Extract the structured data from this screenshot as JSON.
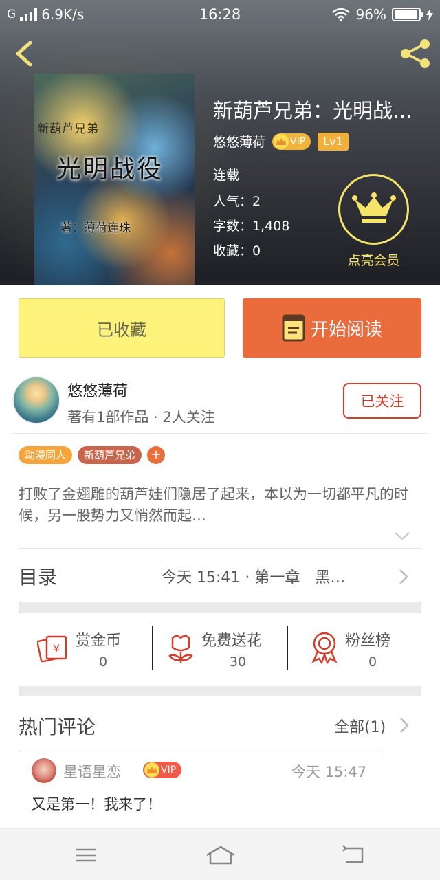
{
  "status_bar": {
    "carrier": "G",
    "speed": "6.9K/s",
    "time": "16:28",
    "battery": "96%"
  },
  "book": {
    "title": "新葫芦兄弟：光明战…",
    "author": "悠悠薄荷",
    "vip_text": "VIP",
    "level": "Lv1",
    "status": "连载",
    "popularity": "人气：2",
    "word_count": "字数：1,408",
    "favorites": "收藏：0",
    "cover": {
      "series": "新葫芦兄弟",
      "title": "光明战役",
      "author": "著：薄荷连珠"
    }
  },
  "member_badge": {
    "label": "点亮会员"
  },
  "buttons": {
    "collected": "已收藏",
    "start_reading": "开始阅读"
  },
  "author_section": {
    "name": "悠悠薄荷",
    "meta": "著有1部作品 · 2人关注",
    "follow": "已关注"
  },
  "tags": [
    {
      "label": "动漫同人",
      "color": "#f5a53a"
    },
    {
      "label": "新葫芦兄弟",
      "color": "#c8664c"
    }
  ],
  "tag_add": "+",
  "description": "打败了金翅雕的葫芦娃们隐居了起来，本以为一切都平凡的时候，另一股势力又悄然而起…",
  "toc": {
    "label": "目录",
    "update": "今天 15:41 · 第一章　黑…"
  },
  "actions": [
    {
      "label": "赏金币",
      "value": "0",
      "icon": "money-envelope-icon"
    },
    {
      "label": "免费送花",
      "value": "30",
      "icon": "flower-icon"
    },
    {
      "label": "粉丝榜",
      "value": "0",
      "icon": "medal-icon"
    }
  ],
  "comments_section": {
    "title": "热门评论",
    "all_link": "全部(1)",
    "items": [
      {
        "user": "星语星恋",
        "vip": "VIP",
        "time": "今天 15:47",
        "text": "又是第一！我来了！"
      }
    ]
  },
  "colors": {
    "accent_orange": "#ea6b3c",
    "collected_yellow": "#fdf27a",
    "follow_red": "#d23d2c",
    "vip_gold": "#f6e36a"
  }
}
